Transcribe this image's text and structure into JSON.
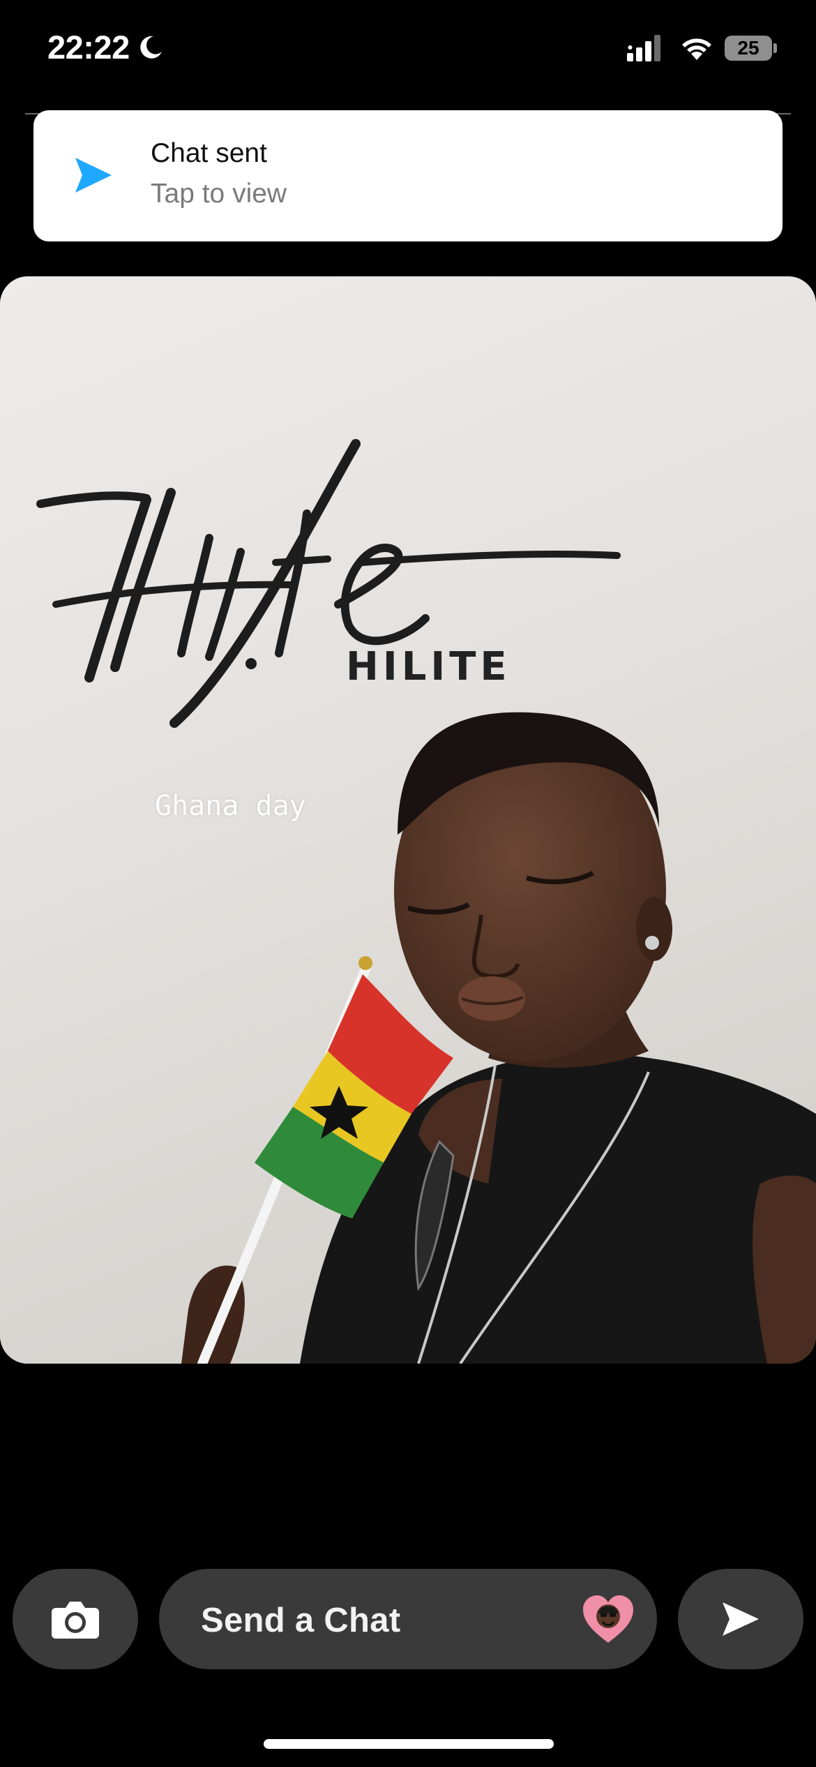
{
  "status_bar": {
    "time": "22:22",
    "battery_level": "25",
    "icons": [
      "moon-icon",
      "cellular-signal-icon",
      "wifi-icon",
      "battery-icon"
    ]
  },
  "notification": {
    "title": "Chat sent",
    "subtitle": "Tap to view",
    "icon": "send-arrow-icon",
    "accent_color": "#1FA8FF"
  },
  "snap": {
    "sign_text": "HILITE",
    "caption": "Ghana day"
  },
  "composer": {
    "placeholder": "Send a Chat",
    "camera_icon": "camera-icon",
    "send_icon": "send-icon",
    "sticker_icon": "bitmoji-heart-icon"
  },
  "colors": {
    "background": "#000000",
    "control_fill": "#3a3a3a",
    "banner_fill": "#ffffff"
  }
}
